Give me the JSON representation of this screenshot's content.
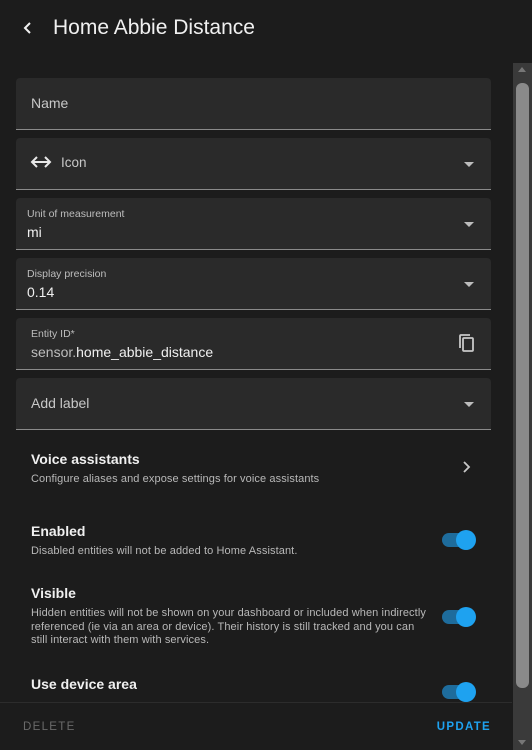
{
  "header": {
    "title": "Home Abbie Distance"
  },
  "fields": {
    "name": {
      "label": "Name"
    },
    "icon": {
      "label": "Icon",
      "icon": "arrow-left-right-icon"
    },
    "unit": {
      "label": "Unit of measurement",
      "value": "mi"
    },
    "precision": {
      "label": "Display precision",
      "value": "0.14"
    },
    "entity_id": {
      "label": "Entity ID*",
      "prefix": "sensor.",
      "value": "home_abbie_distance"
    },
    "label": {
      "label": "Add label"
    }
  },
  "voice": {
    "title": "Voice assistants",
    "description": "Configure aliases and expose settings for voice assistants"
  },
  "enabled": {
    "title": "Enabled",
    "description": "Disabled entities will not be added to Home Assistant.",
    "on": true
  },
  "visible": {
    "title": "Visible",
    "description": "Hidden entities will not be shown on your dashboard or included when indirectly referenced (ie via an area or device). Their history is still tracked and you can still interact with them with services.",
    "on": true
  },
  "device_area": {
    "title": "Use device area",
    "on": true
  },
  "footer": {
    "delete_label": "DELETE",
    "update_label": "UPDATE"
  },
  "colors": {
    "accent": "#1ea2f0",
    "background": "#1c1c1c",
    "field": "#2a2a2a"
  }
}
